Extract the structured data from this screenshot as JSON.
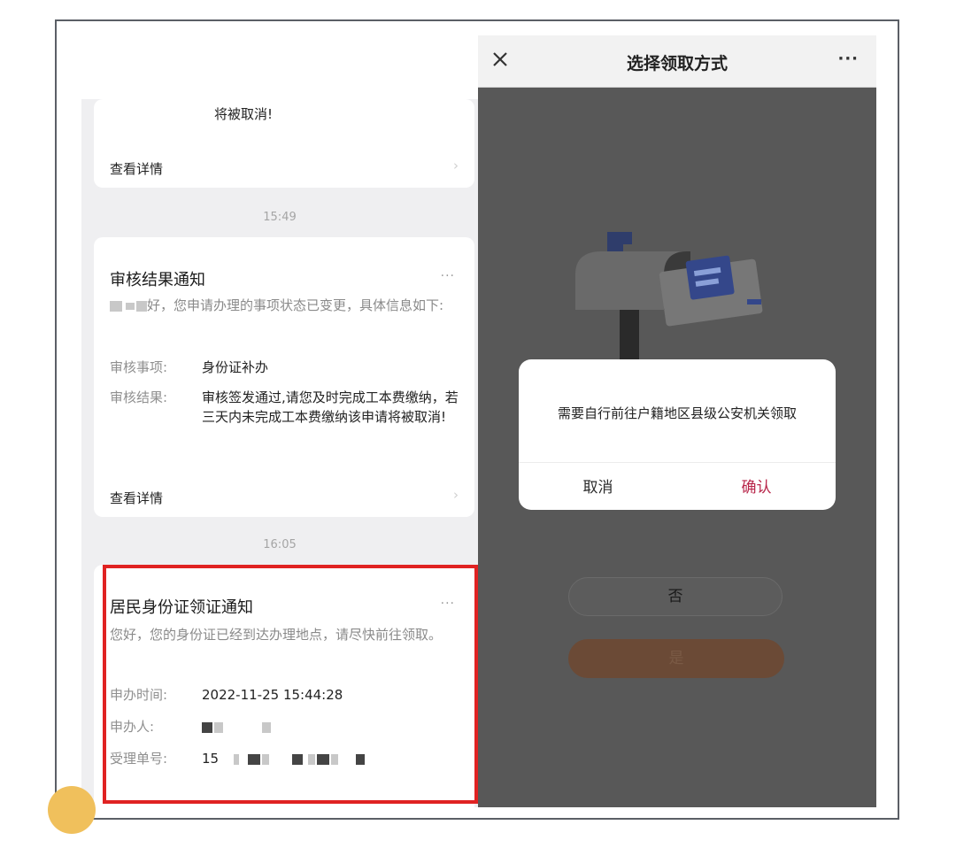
{
  "chat": {
    "card1": {
      "tail_text": "将被取消!",
      "detail_label": "查看详情"
    },
    "time1": "15:49",
    "card2": {
      "title": "审核结果通知",
      "more": "···",
      "desc_suffix": "好，您申请办理的事项状态已变更，具体信息如下:",
      "item_label": "审核事项:",
      "item_value": "身份证补办",
      "result_label": "审核结果:",
      "result_value": "审核签发通过,请您及时完成工本费缴纳，若三天内未完成工本费缴纳该申请将被取消!",
      "detail_label": "查看详情"
    },
    "time2": "16:05",
    "card3": {
      "title": "居民身份证领证通知",
      "more": "···",
      "desc": "您好，您的身份证已经到达办理地点，请尽快前往领取。",
      "apply_time_label": "申办时间:",
      "apply_time_value": "2022-11-25 15:44:28",
      "applicant_label": "申办人:",
      "ticket_label": "受理单号:",
      "ticket_prefix": "15"
    }
  },
  "app": {
    "title": "选择领取方式",
    "more": "···",
    "close_icon": "close-icon",
    "dialog": {
      "message": "需要自行前往户籍地区县级公安机关领取",
      "cancel": "取消",
      "confirm": "确认"
    },
    "no_button": "否",
    "yes_button": "是"
  },
  "colors": {
    "highlight": "#e02222",
    "confirm": "#b8264a",
    "accent_circle": "#f0c05c"
  }
}
